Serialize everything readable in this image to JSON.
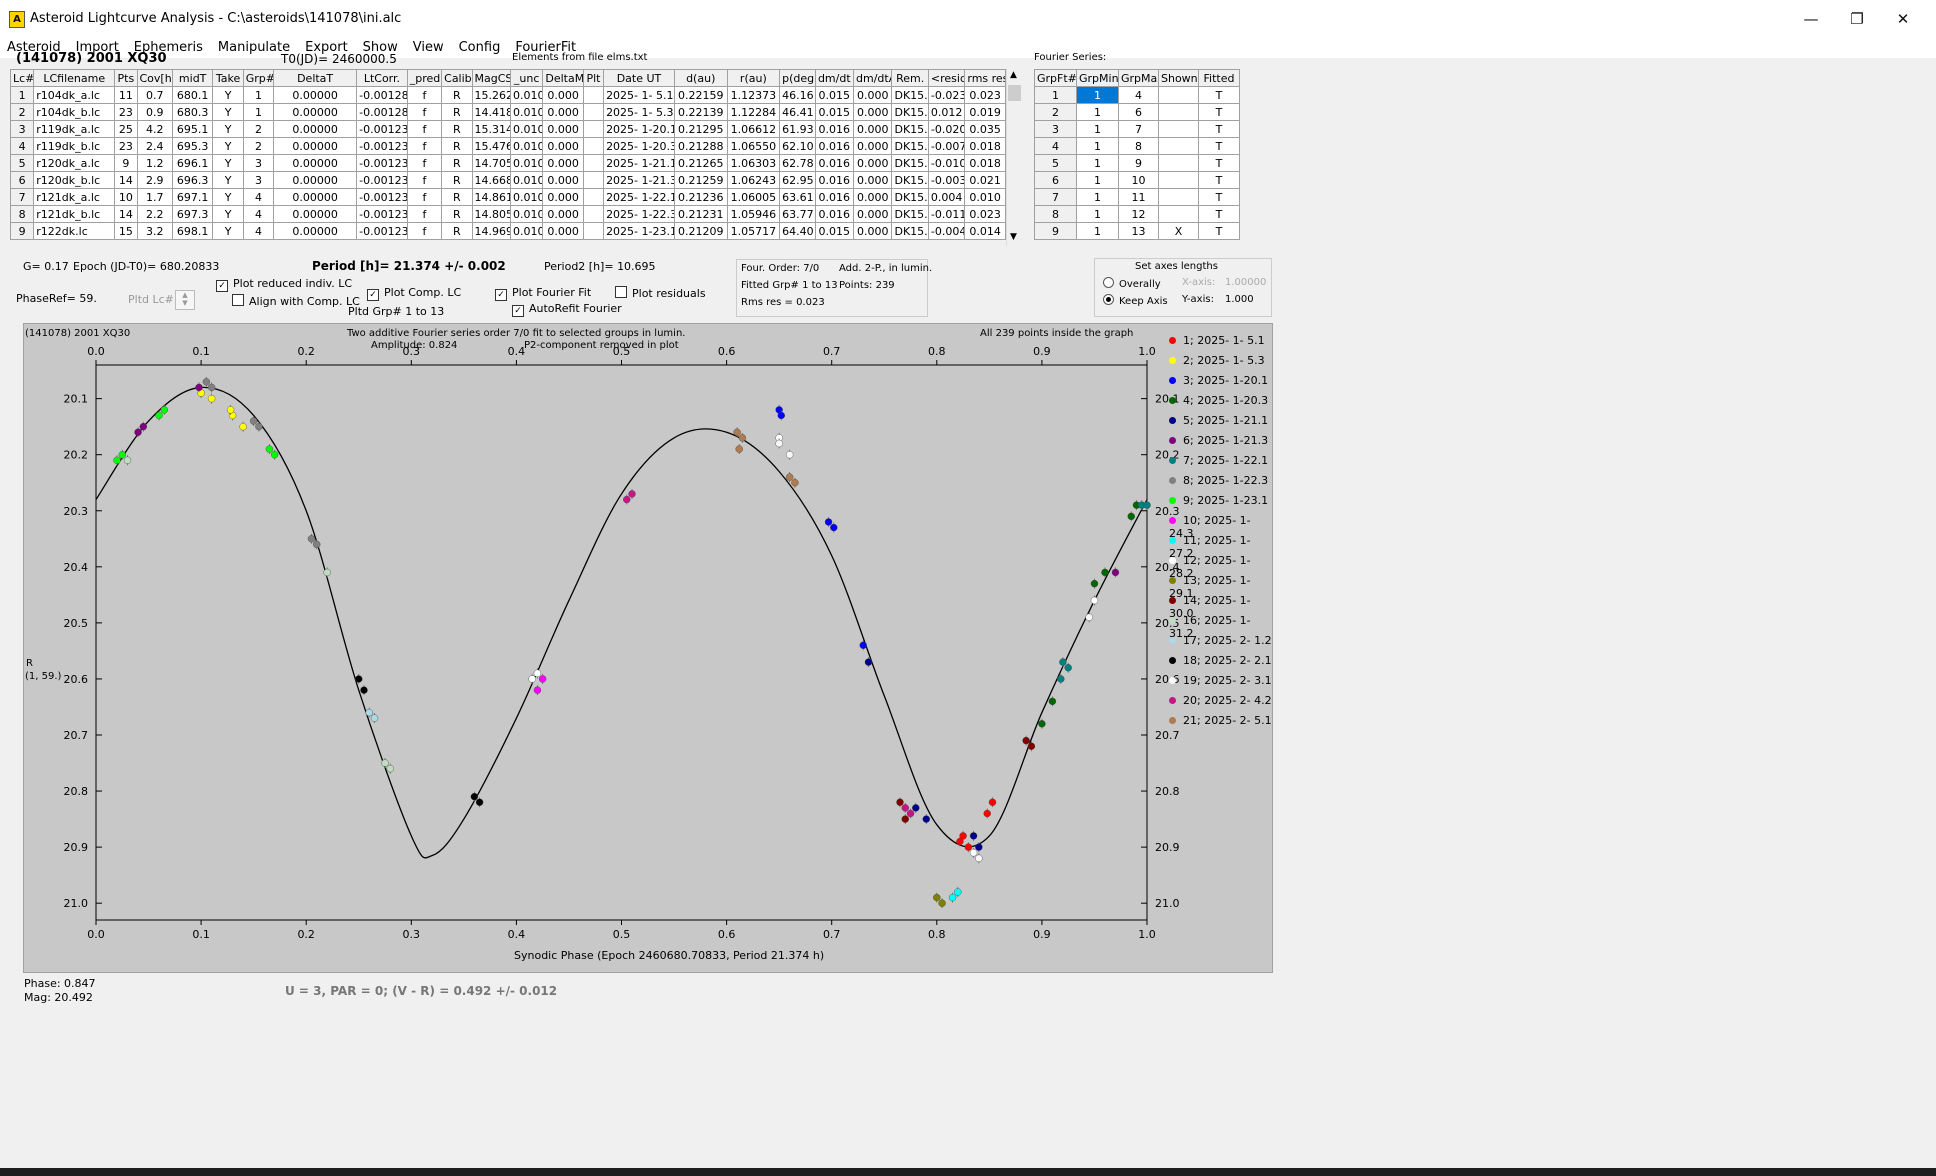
{
  "window": {
    "title": "Asteroid Lightcurve Analysis - C:\\asteroids\\141078\\ini.alc",
    "minimize": "—",
    "maximize": "❐",
    "close": "✕"
  },
  "menu": [
    "Asteroid",
    "Import",
    "Ephemeris",
    "Manipulate",
    "Export",
    "Show",
    "View",
    "Config",
    "FourierFit"
  ],
  "header": {
    "object": "(141078) 2001 XQ30",
    "t0": "T0(JD)= 2460000.5",
    "elements": "Elements from file elms.txt",
    "fourier_title": "Fourier Series:"
  },
  "lc_table": {
    "columns": [
      "Lc#",
      "LCfilename",
      "Pts",
      "Cov[h]",
      "midT",
      "Take",
      "Grp#",
      "DeltaT",
      "LtCorr.",
      "_pred",
      "Calib.",
      "MagCS",
      "_unc",
      "DeltaM",
      "Plt",
      "Date UT",
      "d(au)",
      "r(au)",
      "p(deg)",
      "dm/dt",
      "dm/dtA",
      "Rem.",
      "<resid>",
      "rms res"
    ],
    "rows": [
      [
        "1",
        "r104dk_a.lc",
        "11",
        "0.7",
        "680.1",
        "Y",
        "1",
        "0.00000",
        "-0.00128",
        "f",
        "R",
        "15.262",
        "0.010",
        "0.000",
        "",
        "2025- 1- 5.1",
        "0.22159",
        "1.12373",
        "46.16",
        "0.015",
        "0.000",
        "DK15..",
        "-0.023",
        "0.023"
      ],
      [
        "2",
        "r104dk_b.lc",
        "23",
        "0.9",
        "680.3",
        "Y",
        "1",
        "0.00000",
        "-0.00128",
        "f",
        "R",
        "14.418",
        "0.010",
        "0.000",
        "",
        "2025- 1- 5.3",
        "0.22139",
        "1.12284",
        "46.41",
        "0.015",
        "0.000",
        "DK15..",
        "0.012",
        "0.019"
      ],
      [
        "3",
        "r119dk_a.lc",
        "25",
        "4.2",
        "695.1",
        "Y",
        "2",
        "0.00000",
        "-0.00123",
        "f",
        "R",
        "15.314",
        "0.010",
        "0.000",
        "",
        "2025- 1-20.1",
        "0.21295",
        "1.06612",
        "61.93",
        "0.016",
        "0.000",
        "DK15..",
        "-0.020",
        "0.035"
      ],
      [
        "4",
        "r119dk_b.lc",
        "23",
        "2.4",
        "695.3",
        "Y",
        "2",
        "0.00000",
        "-0.00123",
        "f",
        "R",
        "15.476",
        "0.010",
        "0.000",
        "",
        "2025- 1-20.3",
        "0.21288",
        "1.06550",
        "62.10",
        "0.016",
        "0.000",
        "DK15..",
        "-0.007",
        "0.018"
      ],
      [
        "5",
        "r120dk_a.lc",
        "9",
        "1.2",
        "696.1",
        "Y",
        "3",
        "0.00000",
        "-0.00123",
        "f",
        "R",
        "14.705",
        "0.010",
        "0.000",
        "",
        "2025- 1-21.1",
        "0.21265",
        "1.06303",
        "62.78",
        "0.016",
        "0.000",
        "DK15..",
        "-0.010",
        "0.018"
      ],
      [
        "6",
        "r120dk_b.lc",
        "14",
        "2.9",
        "696.3",
        "Y",
        "3",
        "0.00000",
        "-0.00123",
        "f",
        "R",
        "14.668",
        "0.010",
        "0.000",
        "",
        "2025- 1-21.3",
        "0.21259",
        "1.06243",
        "62.95",
        "0.016",
        "0.000",
        "DK15..",
        "-0.003",
        "0.021"
      ],
      [
        "7",
        "r121dk_a.lc",
        "10",
        "1.7",
        "697.1",
        "Y",
        "4",
        "0.00000",
        "-0.00123",
        "f",
        "R",
        "14.861",
        "0.010",
        "0.000",
        "",
        "2025- 1-22.1",
        "0.21236",
        "1.06005",
        "63.61",
        "0.016",
        "0.000",
        "DK15..",
        "0.004",
        "0.010"
      ],
      [
        "8",
        "r121dk_b.lc",
        "14",
        "2.2",
        "697.3",
        "Y",
        "4",
        "0.00000",
        "-0.00123",
        "f",
        "R",
        "14.805",
        "0.010",
        "0.000",
        "",
        "2025- 1-22.3",
        "0.21231",
        "1.05946",
        "63.77",
        "0.016",
        "0.000",
        "DK15..",
        "-0.011",
        "0.023"
      ],
      [
        "9",
        "r122dk.lc",
        "15",
        "3.2",
        "698.1",
        "Y",
        "4",
        "0.00000",
        "-0.00123",
        "f",
        "R",
        "14.969",
        "0.010",
        "0.000",
        "",
        "2025- 1-23.1",
        "0.21209",
        "1.05717",
        "64.40",
        "0.015",
        "0.000",
        "DK15..",
        "-0.004",
        "0.014"
      ]
    ]
  },
  "fourier_table": {
    "columns": [
      "GrpFt#",
      "GrpMin",
      "GrpMax",
      "Shown",
      "Fitted"
    ],
    "rows": [
      [
        "1",
        "1",
        "4",
        "",
        "T"
      ],
      [
        "2",
        "1",
        "6",
        "",
        "T"
      ],
      [
        "3",
        "1",
        "7",
        "",
        "T"
      ],
      [
        "4",
        "1",
        "8",
        "",
        "T"
      ],
      [
        "5",
        "1",
        "9",
        "",
        "T"
      ],
      [
        "6",
        "1",
        "10",
        "",
        "T"
      ],
      [
        "7",
        "1",
        "11",
        "",
        "T"
      ],
      [
        "8",
        "1",
        "12",
        "",
        "T"
      ],
      [
        "9",
        "1",
        "13",
        "X",
        "T"
      ]
    ]
  },
  "controls": {
    "g": "G= 0.17",
    "epoch": "Epoch (JD-T0)= 680.20833",
    "period": "Period [h]= 21.374 +/- 0.002",
    "period2": "Period2 [h]= 10.695",
    "phaseref": "PhaseRef= 59.",
    "pltd_lc": "Pltd Lc#:",
    "plot_reduced": "Plot reduced indiv. LC",
    "align_comp": "Align with Comp. LC",
    "plot_comp": "Plot Comp. LC",
    "pltd_grp": "Pltd Grp#  1  to  13",
    "plot_fourier": "Plot Fourier Fit",
    "autorefit": "AutoRefit Fourier",
    "plot_resid": "Plot residuals",
    "four_order": "Four. Order:  7/0",
    "add2p": "Add. 2-P., in lumin.",
    "fitted_grp": "Fitted Grp# 1 to 13",
    "points": "Points: 239",
    "rms": "Rms res     = 0.023",
    "axes_title": "Set axes lengths",
    "overally": "Overally",
    "keep_axis": "Keep Axis",
    "xaxis_label": "X-axis:",
    "xaxis_value": "1.00000",
    "yaxis_label": "Y-axis:",
    "yaxis_value": "1.000"
  },
  "plot": {
    "object": "(141078) 2001 XQ30",
    "line1": "Two additive Fourier series order 7/0 fit to selected groups in lumin.",
    "line2a": "Amplitude: 0.824",
    "line2b": "P2-component removed in plot",
    "points_note": "All 239 points inside the graph",
    "ylabel1": "R",
    "ylabel2": "(1, 59.)",
    "xlabel": "Synodic Phase (Epoch 2460680.70833, Period 21.374 h)"
  },
  "chart_data": {
    "type": "scatter",
    "xlim": [
      0,
      1.0
    ],
    "ylim": [
      21.03,
      20.04
    ],
    "y_inverted": true,
    "x_ticks": [
      "0.0",
      "0.1",
      "0.2",
      "0.3",
      "0.4",
      "0.5",
      "0.6",
      "0.7",
      "0.8",
      "0.9",
      "1.0"
    ],
    "y_ticks": [
      "20.1",
      "20.2",
      "20.3",
      "20.4",
      "20.5",
      "20.6",
      "20.7",
      "20.8",
      "20.9",
      "21.0"
    ],
    "fit_curve": {
      "x": [
        0,
        0.05,
        0.1,
        0.15,
        0.2,
        0.25,
        0.3,
        0.32,
        0.35,
        0.4,
        0.45,
        0.5,
        0.55,
        0.6,
        0.65,
        0.7,
        0.75,
        0.8,
        0.85,
        0.9,
        0.95,
        1.0
      ],
      "y": [
        20.28,
        20.14,
        20.08,
        20.13,
        20.3,
        20.62,
        20.88,
        20.915,
        20.85,
        20.67,
        20.46,
        20.27,
        20.17,
        20.16,
        20.23,
        20.38,
        20.63,
        20.86,
        20.88,
        20.66,
        20.46,
        20.28
      ]
    },
    "series": [
      {
        "name": "1; 2025- 1- 5.1",
        "color": "#ff0000",
        "points": [
          [
            0.825,
            20.88
          ],
          [
            0.83,
            20.9
          ],
          [
            0.848,
            20.84
          ],
          [
            0.853,
            20.82
          ],
          [
            0.822,
            20.89
          ]
        ]
      },
      {
        "name": "2; 2025- 1- 5.3",
        "color": "#ffff00",
        "points": [
          [
            0.1,
            20.09
          ],
          [
            0.11,
            20.1
          ],
          [
            0.13,
            20.13
          ],
          [
            0.14,
            20.15
          ],
          [
            0.128,
            20.12
          ]
        ]
      },
      {
        "name": "3; 2025- 1-20.1",
        "color": "#0000ff",
        "points": [
          [
            0.65,
            20.12
          ],
          [
            0.652,
            20.13
          ],
          [
            0.697,
            20.32
          ],
          [
            0.702,
            20.33
          ],
          [
            0.73,
            20.54
          ]
        ]
      },
      {
        "name": "4; 2025- 1-20.3",
        "color": "#006600",
        "points": [
          [
            0.9,
            20.68
          ],
          [
            0.91,
            20.64
          ],
          [
            0.95,
            20.43
          ],
          [
            0.96,
            20.41
          ],
          [
            0.985,
            20.31
          ],
          [
            0.99,
            20.29
          ]
        ]
      },
      {
        "name": "5; 2025- 1-21.1",
        "color": "#00008b",
        "points": [
          [
            0.78,
            20.83
          ],
          [
            0.79,
            20.85
          ],
          [
            0.835,
            20.88
          ],
          [
            0.84,
            20.9
          ],
          [
            0.735,
            20.57
          ]
        ]
      },
      {
        "name": "6; 2025- 1-21.3",
        "color": "#7f007f",
        "points": [
          [
            0.04,
            20.16
          ],
          [
            0.045,
            20.15
          ],
          [
            0.098,
            20.08
          ],
          [
            0.97,
            20.41
          ]
        ]
      },
      {
        "name": "7; 2025- 1-22.1",
        "color": "#008080",
        "points": [
          [
            0.92,
            20.57
          ],
          [
            0.925,
            20.58
          ],
          [
            0.918,
            20.6
          ],
          [
            0.995,
            20.29
          ],
          [
            1.0,
            20.29
          ]
        ]
      },
      {
        "name": "8; 2025- 1-22.3",
        "color": "#808080",
        "points": [
          [
            0.105,
            20.07
          ],
          [
            0.11,
            20.08
          ],
          [
            0.15,
            20.14
          ],
          [
            0.155,
            20.15
          ],
          [
            0.205,
            20.35
          ],
          [
            0.21,
            20.36
          ]
        ]
      },
      {
        "name": "9; 2025- 1-23.1",
        "color": "#00ff00",
        "points": [
          [
            0.02,
            20.21
          ],
          [
            0.025,
            20.2
          ],
          [
            0.06,
            20.13
          ],
          [
            0.065,
            20.12
          ],
          [
            0.165,
            20.19
          ],
          [
            0.17,
            20.2
          ]
        ]
      },
      {
        "name": "10; 2025- 1-24.3",
        "color": "#ff00ff",
        "points": [
          [
            0.42,
            20.62
          ],
          [
            0.425,
            20.6
          ]
        ]
      },
      {
        "name": "11; 2025- 1-27.2",
        "color": "#00ffff",
        "points": [
          [
            0.815,
            20.99
          ],
          [
            0.82,
            20.98
          ]
        ]
      },
      {
        "name": "12; 2025- 1-28.2",
        "color": "#ffffff",
        "points": [
          [
            0.415,
            20.6
          ],
          [
            0.42,
            20.59
          ],
          [
            0.65,
            20.17
          ],
          [
            0.835,
            20.91
          ],
          [
            0.95,
            20.46
          ]
        ]
      },
      {
        "name": "13; 2025- 1-29.1",
        "color": "#808000",
        "points": [
          [
            0.8,
            20.99
          ],
          [
            0.805,
            21.0
          ]
        ]
      },
      {
        "name": "14; 2025- 1-30.0",
        "color": "#800000",
        "points": [
          [
            0.765,
            20.82
          ],
          [
            0.77,
            20.85
          ],
          [
            0.885,
            20.71
          ],
          [
            0.89,
            20.72
          ]
        ]
      },
      {
        "name": "16; 2025- 1-31.2",
        "color": "#c0dcc0",
        "points": [
          [
            0.22,
            20.41
          ],
          [
            0.275,
            20.75
          ],
          [
            0.28,
            20.76
          ],
          [
            0.03,
            20.21
          ]
        ]
      },
      {
        "name": "17; 2025- 2- 1.2",
        "color": "#add8e6",
        "points": [
          [
            0.26,
            20.66
          ],
          [
            0.265,
            20.67
          ]
        ]
      },
      {
        "name": "18; 2025- 2- 2.1",
        "color": "#000000",
        "points": [
          [
            0.25,
            20.6
          ],
          [
            0.255,
            20.62
          ],
          [
            0.36,
            20.81
          ],
          [
            0.365,
            20.82
          ]
        ]
      },
      {
        "name": "19; 2025- 2- 3.1",
        "color": "#f8f8f8",
        "points": [
          [
            0.65,
            20.18
          ],
          [
            0.66,
            20.2
          ],
          [
            0.84,
            20.92
          ],
          [
            0.945,
            20.49
          ]
        ]
      },
      {
        "name": "20; 2025- 2- 4.2",
        "color": "#c71585",
        "points": [
          [
            0.505,
            20.28
          ],
          [
            0.51,
            20.27
          ],
          [
            0.77,
            20.83
          ],
          [
            0.775,
            20.84
          ]
        ]
      },
      {
        "name": "21; 2025- 2- 5.1",
        "color": "#b07b4f",
        "points": [
          [
            0.61,
            20.16
          ],
          [
            0.615,
            20.17
          ],
          [
            0.66,
            20.24
          ],
          [
            0.665,
            20.25
          ],
          [
            0.612,
            20.19
          ]
        ]
      }
    ]
  },
  "status": {
    "phase": "Phase:  0.847",
    "mag": "Mag:    20.492",
    "result": "U = 3, PAR = 0; (V - R) = 0.492 +/- 0.012"
  }
}
